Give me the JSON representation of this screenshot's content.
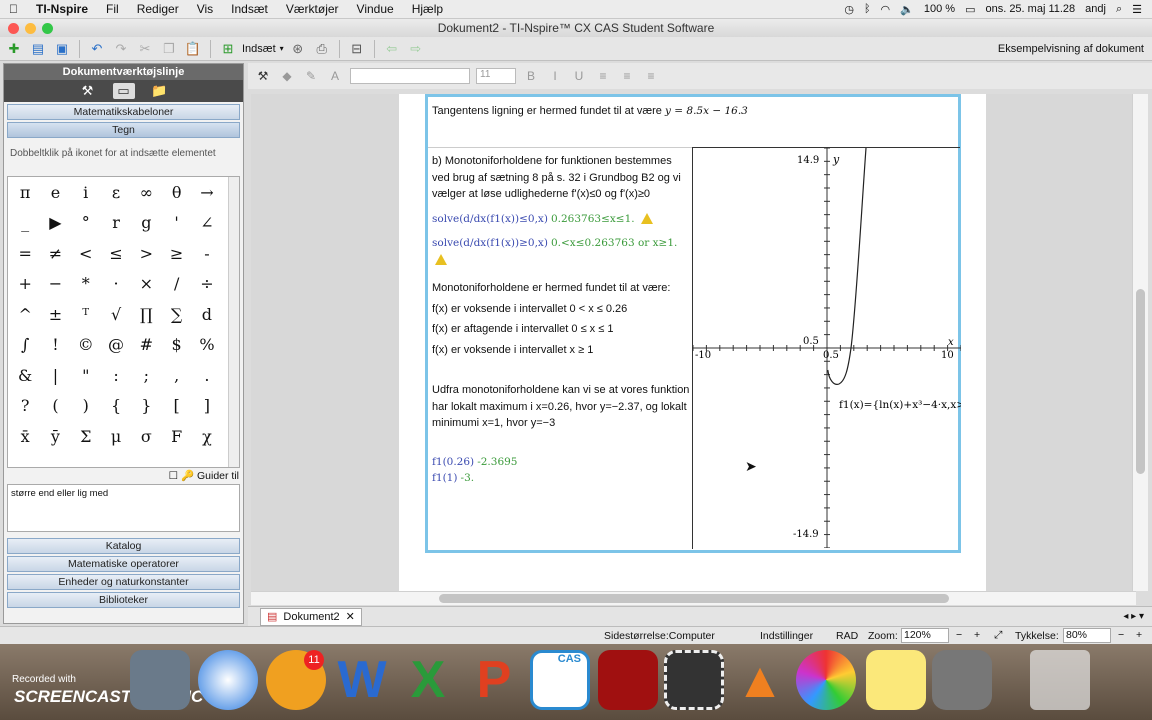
{
  "menubar": {
    "app": "TI-Nspire",
    "items": [
      "Fil",
      "Rediger",
      "Vis",
      "Indsæt",
      "Værktøjer",
      "Vindue",
      "Hjælp"
    ],
    "battery": "100 %",
    "datetime": "ons. 25. maj 11.28",
    "user": "andj"
  },
  "window": {
    "title": "Dokument2 - TI-Nspire™ CX CAS Student Software"
  },
  "toolbar": {
    "insert_label": "Indsæt",
    "preview_label": "Eksempelvisning af dokument"
  },
  "formatbar": {
    "font_size": "11"
  },
  "left_panel": {
    "title": "Dokumentværktøjslinje",
    "btn_templates": "Matematikskabeloner",
    "btn_draw": "Tegn",
    "hint": "Dobbeltklik på ikonet for at indsætte elementet",
    "symbols": [
      [
        "π",
        "e",
        "i",
        "ε",
        "∞",
        "θ",
        "→"
      ],
      [
        "_",
        "▶",
        "°",
        "r",
        "g",
        "'",
        "∠"
      ],
      [
        "=",
        "≠",
        "<",
        "≤",
        ">",
        "≥",
        "-"
      ],
      [
        "+",
        "−",
        "*",
        "·",
        "×",
        "/",
        "÷"
      ],
      [
        "^",
        "±",
        "ᵀ",
        "√",
        "∏",
        "∑",
        "d"
      ],
      [
        "∫",
        "!",
        "©",
        "@",
        "#",
        "$",
        "%"
      ],
      [
        "&",
        "|",
        "\"",
        ":",
        ";",
        ",",
        "."
      ],
      [
        "?",
        "(",
        ")",
        "{",
        "}",
        "[",
        "]"
      ],
      [
        "x̄",
        "ȳ",
        "Σ",
        "μ",
        "σ",
        "F",
        "χ"
      ]
    ],
    "guide_label": "Guider til",
    "description": "større end eller lig med",
    "btn_catalog": "Katalog",
    "btn_operators": "Matematiske operatorer",
    "btn_units": "Enheder og naturkonstanter",
    "btn_libraries": "Biblioteker"
  },
  "document": {
    "tangent_text": "Tangentens ligning er hermed fundet til at være",
    "tangent_eq": "y = 8.5x − 16.3",
    "part_b": "b)  Monotoniforholdene for funktionen bestemmes ved brug af sætning 8 på s. 32 i Grundbog B2 og vi vælger at løse udlighederne f'(x)≤0 og f'(x)≥0",
    "solve1": "solve(d/dx(f1(x))≤0,x)",
    "solve1_result": "0.263763≤x≤1.",
    "solve2": "solve(d/dx(f1(x))≥0,x)",
    "solve2_result": "0.<x≤0.263763 or x≥1.",
    "conclusion": "Monotoniforholdene er hermed fundet til at være:",
    "mono1": "f(x) er voksende i intervallet  0 < x ≤ 0.26",
    "mono2": "f(x) er aftagende i intervallet  0 ≤ x ≤ 1",
    "mono3": "f(x) er voksende i intervallet  x ≥ 1",
    "extrema": "Udfra monotoniforholdene kan vi se at vores funktion har lokalt maximum i x=0.26, hvor y=−2.37, og lokalt minimumi x=1, hvor y=−3",
    "eval1": "f1(0.26)",
    "eval1_result": "-2.3695",
    "eval2": "f1(1)",
    "eval2_result": "-3."
  },
  "graph": {
    "y_max_label": "14.9",
    "y_min_label": "-14.9",
    "x_min_label": "-10",
    "x_max_label": "10",
    "x_tick_label": "0.5",
    "y_tick_label": "0.5",
    "y_axis_name": "y",
    "x_axis_name": "x",
    "function_label": "f1(x)={ln(x)+x³−4·x,x>"
  },
  "tabbar": {
    "tab_label": "Dokument2"
  },
  "statusbar": {
    "page_size": "Sidestørrelse:Computer",
    "settings": "Indstillinger",
    "angle": "RAD",
    "zoom_label": "Zoom:",
    "zoom_value": "120%",
    "thickness_label": "Tykkelse:",
    "thickness_value": "80%"
  },
  "dock": {
    "recorded": "Recorded with",
    "brand": "SCREENCAST",
    "brand2": "MATIC",
    "badge": "11",
    "cas": "CAS"
  }
}
